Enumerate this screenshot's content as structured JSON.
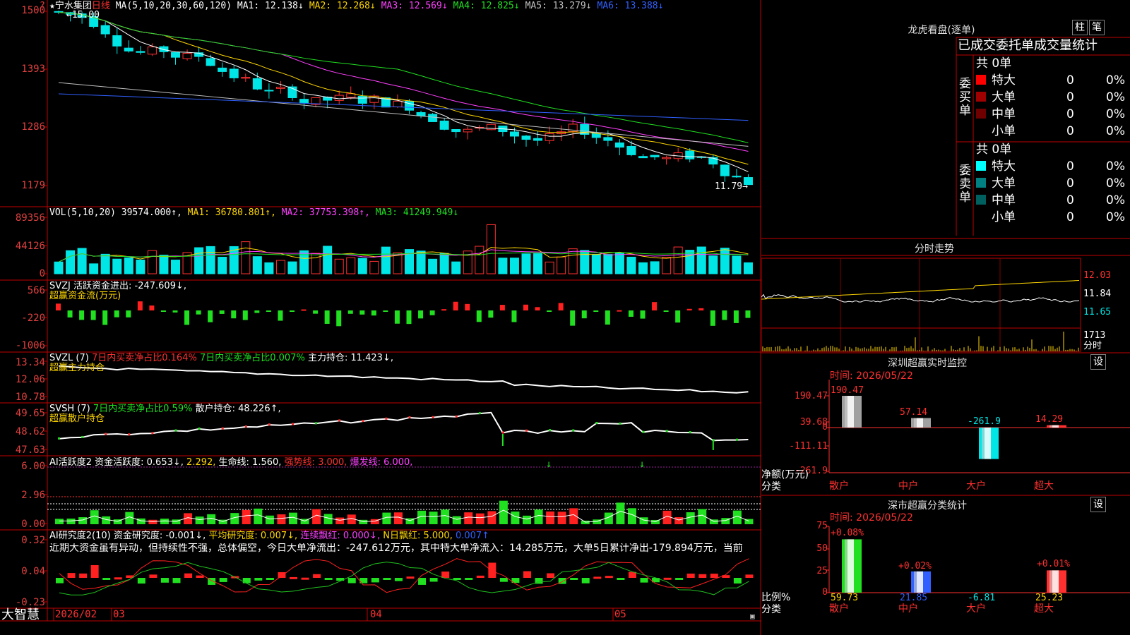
{
  "header": {
    "top_left_mark": "?",
    "star": "★",
    "stock_name": "宁水集团",
    "period": "日线",
    "ma_caption": "MA(5,10,20,30,60,120)",
    "ma_items": [
      {
        "text": "MA1: 12.138↓",
        "color": "#ffffff"
      },
      {
        "text": "MA2: 12.268↓",
        "color": "#ffd700"
      },
      {
        "text": "MA3: 12.569↓",
        "color": "#ff40ff"
      },
      {
        "text": "MA4: 12.825↓",
        "color": "#20e020"
      },
      {
        "text": "MA5: 13.279↓",
        "color": "#c0c0c0"
      },
      {
        "text": "MA6: 13.388↓",
        "color": "#3060ff"
      }
    ],
    "max_marker": "←15.00",
    "min_marker": "11.79→"
  },
  "price_axis": [
    "1500",
    "1393",
    "1286",
    "1179"
  ],
  "vol": {
    "caption": "VOL(5,10,20)",
    "value": "39574.000↑,",
    "ma1": "MA1: 36780.801↑,",
    "ma2": "MA2: 37753.398↑,",
    "ma3": "MA3: 41249.949↓",
    "axis": [
      "89356",
      "44126",
      "0"
    ]
  },
  "svzj": {
    "caption": "SVZJ  活跃资金进出: -247.609↓,",
    "sub": "超赢资金流(万元)",
    "axis": [
      "566",
      "-220",
      "-1006"
    ]
  },
  "svzl": {
    "caption": "SVZL (7)",
    "t1": "7日内买卖净占比0.164%",
    "t2": "7日内买卖净占比0.007%",
    "t3": "主力持仓: 11.423↓,",
    "sub": "超赢主力持仓",
    "axis": [
      "13.34",
      "12.06",
      "10.78"
    ]
  },
  "svsh": {
    "caption": "SVSH (7)",
    "t1": "7日内买卖净占比0.59%",
    "t2": "散户持仓: 48.226↑,",
    "sub": "超赢散户持仓",
    "axis": [
      "49.65",
      "48.62",
      "47.63"
    ]
  },
  "ai_active": {
    "caption": "AI活跃度2",
    "t1": "资金活跃度: 0.653↓,",
    "t2": "2.292,",
    "t3": "生命线: 1.560,",
    "t4": "强势线: 3.000,",
    "t5": "爆发线: 6.000,",
    "axis": [
      "6.00",
      "2.96",
      "0.00"
    ]
  },
  "ai_research": {
    "caption": "AI研究度2(10)",
    "t1": "资金研究度: -0.001↓,",
    "t2": "平均研究度: 0.007↓,",
    "t3": "连续飘红: 0.000↓,",
    "t4": "N日飘红: 5.000,",
    "t5": "0.007↑",
    "comment": "近期大资金虽有异动，但持续性不强，总体偏空，今日大单净流出：-247.612万元，其中特大单净流入：14.285万元，大单5日累计净出-179.894万元，当前",
    "axis": [
      "0.32",
      "0.04",
      "-0.23"
    ]
  },
  "footer": {
    "brand": "大智慧",
    "dates": [
      "2026/02",
      "03",
      "04",
      "05"
    ]
  },
  "longhu": {
    "title": "龙虎看盘(逐单)",
    "btn1": "柱",
    "btn2": "笔",
    "subtitle": "已成交委托单成交量统计",
    "buy_label": "委买单",
    "sell_label": "委卖单",
    "buy_total": "共 0单",
    "sell_total": "共 0单",
    "buy_rows": [
      {
        "name": "特大",
        "count": "0",
        "pct": "0%",
        "color": "#ff0000"
      },
      {
        "name": "大单",
        "count": "0",
        "pct": "0%",
        "color": "#a00000"
      },
      {
        "name": "中单",
        "count": "0",
        "pct": "0%",
        "color": "#700000"
      },
      {
        "name": "小单",
        "count": "0",
        "pct": "0%",
        "color": ""
      }
    ],
    "sell_rows": [
      {
        "name": "特大",
        "count": "0",
        "pct": "0%",
        "color": "#00ffff"
      },
      {
        "name": "大单",
        "count": "0",
        "pct": "0%",
        "color": "#008080"
      },
      {
        "name": "中单",
        "count": "0",
        "pct": "0%",
        "color": "#006060"
      },
      {
        "name": "小单",
        "count": "0",
        "pct": "0%",
        "color": ""
      }
    ]
  },
  "intraday": {
    "title": "分时走势",
    "axis": [
      "12.03",
      "11.84",
      "11.65"
    ],
    "vol_label": "1713",
    "vol_unit": "分时"
  },
  "sz_monitor": {
    "title": "深圳超赢实时监控",
    "settings": "设",
    "time": "时间: 2026/05/22",
    "axis": [
      "190.47",
      "39.68",
      "0",
      "-111.11",
      "-261.9"
    ],
    "ylabel": "净额(万元)",
    "xlabel": "分类",
    "values": [
      "190.47",
      "57.14",
      "-261.9",
      "14.29"
    ],
    "categories": [
      "散户",
      "中户",
      "大户",
      "超大"
    ]
  },
  "sz_class": {
    "title": "深市超赢分类统计",
    "settings": "设",
    "time": "时间: 2026/05/22",
    "axis": [
      "75",
      "50",
      "25",
      "0"
    ],
    "ylabel": "比例%",
    "xlabel": "分类",
    "top_values": [
      "+0.08%",
      "+0.02%",
      "+0.01%"
    ],
    "values": [
      "59.73",
      "21.85",
      "-6.81",
      "25.23"
    ],
    "categories": [
      "散户",
      "中户",
      "大户",
      "超大"
    ]
  }
}
